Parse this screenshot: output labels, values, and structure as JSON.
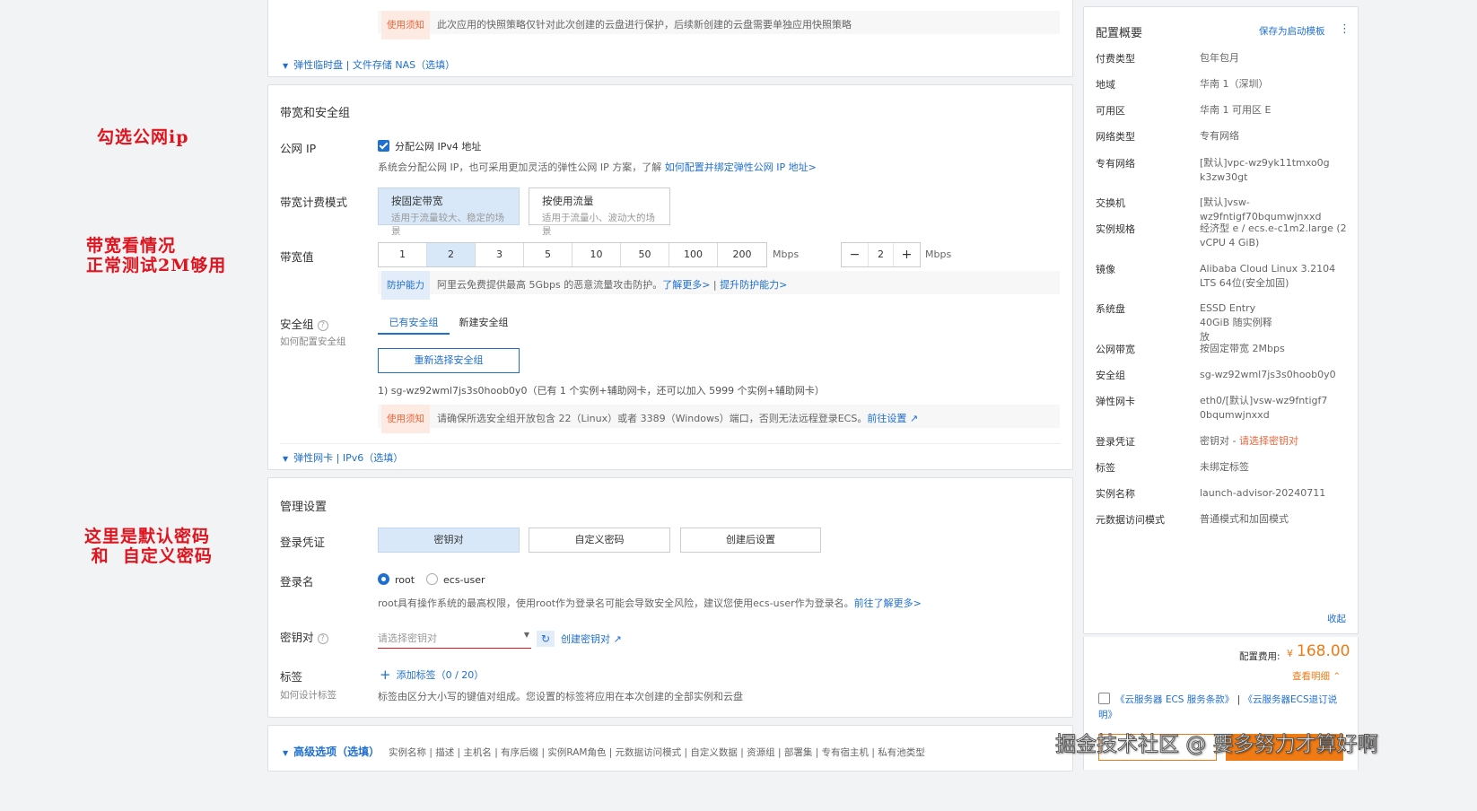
{
  "annotations": {
    "public_ip": "勾选公网ip",
    "bandwidth": "带宽看情况\n正常测试2M够用",
    "password": "这里是默认密码\n 和  自定义密码"
  },
  "top": {
    "notice_tag": "使用须知",
    "notice_text": "此次应用的快照策略仅针对此次创建的云盘进行保护，后续新创建的云盘需要单独应用快照策略",
    "expander": "弹性临时盘 | 文件存储 NAS（选填）"
  },
  "network": {
    "section_title": "带宽和安全组",
    "public_ip_label": "公网 IP",
    "public_ip_checkbox": "分配公网 IPv4 地址",
    "public_ip_note": "系统会分配公网 IP，也可采用更加灵活的弹性公网 IP 方案，了解",
    "public_ip_link": "如何配置并绑定弹性公网 IP 地址>",
    "billing_label": "带宽计费模式",
    "billing_options": [
      {
        "title": "按固定带宽",
        "desc": "适用于流量较大、稳定的场景"
      },
      {
        "title": "按使用流量",
        "desc": "适用于流量小、波动大的场景"
      }
    ],
    "bandwidth_label": "带宽值",
    "bandwidth_values": [
      "1",
      "2",
      "3",
      "5",
      "10",
      "50",
      "100",
      "200"
    ],
    "bandwidth_selected": "2",
    "unit": "Mbps",
    "stepper_value": "2",
    "stepper_minus": "−",
    "stepper_plus": "+",
    "protection_tag": "防护能力",
    "protection_text": "阿里云免费提供最高 5Gbps 的恶意流量攻击防护。",
    "protection_link1": "了解更多>",
    "protection_sep": " | ",
    "protection_link2": "提升防护能力>",
    "sg_label": "安全组",
    "sg_help": "?",
    "sg_sub": "如何配置安全组",
    "sg_tabs": [
      "已有安全组",
      "新建安全组"
    ],
    "sg_button": "重新选择安全组",
    "sg_selected": "1) sg-wz92wml7js3s0hoob0y0（已有 1 个实例+辅助网卡，还可以加入 5999 个实例+辅助网卡）",
    "sg_notice_tag": "使用须知",
    "sg_notice_text": "请确保所选安全组开放包含 22（Linux）或者 3389（Windows）端口，否则无法远程登录ECS。",
    "sg_notice_link": "前往设置",
    "expander": "弹性网卡 | IPv6（选填）"
  },
  "management": {
    "section_title": "管理设置",
    "credential_label": "登录凭证",
    "credential_options": [
      "密钥对",
      "自定义密码",
      "创建后设置"
    ],
    "credential_selected": "密钥对",
    "login_name_label": "登录名",
    "login_names": [
      "root",
      "ecs-user"
    ],
    "login_note": "root具有操作系统的最高权限，使用root作为登录名可能会导致安全风险，建议您使用ecs-user作为登录名。",
    "login_note_link": "前往了解更多>",
    "keypair_label": "密钥对",
    "keypair_placeholder": "请选择密钥对",
    "keypair_create": "创建密钥对",
    "tags_label": "标签",
    "tags_sub": "如何设计标签",
    "tags_add": "添加标签",
    "tags_count": "（0 / 20）",
    "tags_note": "标签由区分大小写的键值对组成。您设置的标签将应用在本次创建的全部实例和云盘"
  },
  "advanced": {
    "title": "高级选项（选填）",
    "items": "实例名称 | 描述 | 主机名 | 有序后缀 | 实例RAM角色 | 元数据访问模式 | 自定义数据 | 资源组 | 部署集 | 专有宿主机 | 私有池类型"
  },
  "summary": {
    "title": "配置概要",
    "save_template": "保存为启动模板",
    "more_icon": "⋮",
    "rows": [
      {
        "k": "付费类型",
        "v": "包年包月"
      },
      {
        "k": "地域",
        "v": "华南 1（深圳）"
      },
      {
        "k": "可用区",
        "v": "华南 1 可用区 E"
      },
      {
        "k": "网络类型",
        "v": "专有网络"
      },
      {
        "k": "专有网络",
        "v": "[默认]vpc-wz9yk11tmxo0gk3zw30gt"
      },
      {
        "k": "交换机",
        "v": "[默认]vsw-wz9fntigf70bqumwjnxxd"
      },
      {
        "k": "实例规格",
        "v": "经济型 e / ecs.e-c1m2.large (2 vCPU 4 GiB)"
      },
      {
        "k": "镜像",
        "v": "Alibaba Cloud Linux 3.2104 LTS 64位(安全加固)"
      },
      {
        "k": "系统盘",
        "v": "ESSD Entry 40GiB 随实例释放"
      },
      {
        "k": "公网带宽",
        "v": "按固定带宽 2Mbps"
      },
      {
        "k": "安全组",
        "v": "sg-wz92wml7js3s0hoob0y0"
      },
      {
        "k": "弹性网卡",
        "v": "eth0/[默认]vsw-wz9fntigf70bqumwjnxxd"
      },
      {
        "k": "登录凭证",
        "v": "密钥对 - "
      },
      {
        "k": "标签",
        "v": "未绑定标签"
      },
      {
        "k": "实例名称",
        "v": "launch-advisor-20240711"
      },
      {
        "k": "元数据访问模式",
        "v": "普通模式和加固模式"
      }
    ],
    "credential_warning": "请选择密钥对",
    "collapse": "收起",
    "fee_label": "配置费用:",
    "currency": "¥",
    "fee": "168.00",
    "fee_detail": "查看明细",
    "agreement_1": "《云服务器 ECS 服务条款》",
    "agreement_sep": " | ",
    "agreement_2": "《云服务器ECS退订说明》"
  },
  "watermark": "掘金技术社区 @ 要多努力才算好啊",
  "colors": {
    "accent": "#1f6fd1",
    "warning": "#e8663b",
    "price": "#f07a13",
    "annotation": "#e0141e"
  }
}
